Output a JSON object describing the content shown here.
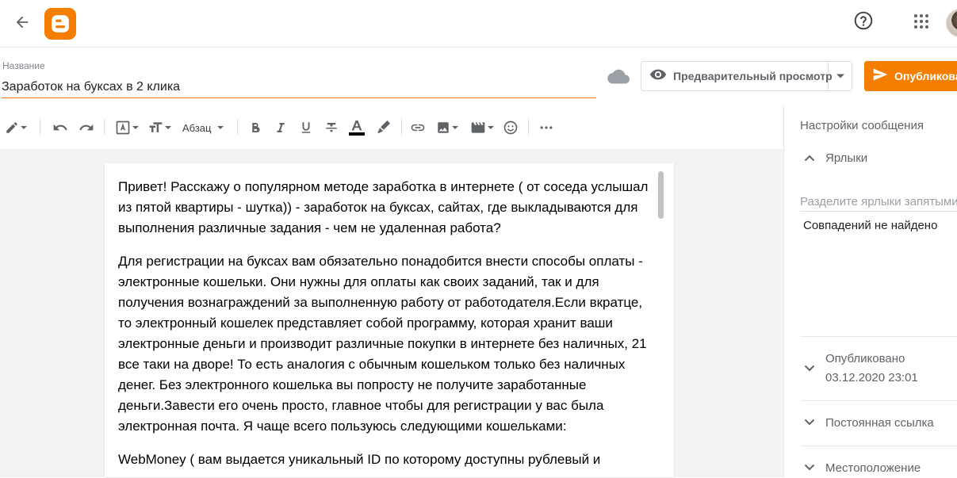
{
  "header": {
    "back_icon": "arrow-back-icon",
    "logo_icon": "blogger-logo-icon",
    "help_icon": "help-circle-icon",
    "apps_icon": "apps-grid-icon",
    "brand_color": "#f57d00"
  },
  "post": {
    "title_label": "Название",
    "title_value": "Заработок на буксах в 2 клика"
  },
  "actions": {
    "preview_label": "Предварительный просмотр",
    "publish_label": "Опубликовать"
  },
  "toolbar": {
    "paragraph_label": "Абзац"
  },
  "content": {
    "paragraphs": [
      "Привет! Расскажу о популярном методе заработка в интернете ( от соседа услышал из пятой квартиры - шутка)) - заработок на буксах, сайтах, где выкладываются для выполнения различные задания - чем не удаленная работа?",
      "Для регистрации на буксах вам обязательно понадобится внести способы оплаты - электронные кошельки. Они нужны для оплаты как своих заданий, так и для получения вознаграждений за выполненную работу от работодателя.Если вкратце, то электронный кошелек представляет собой программу, которая хранит ваши электронные деньги и производит различные покупки в интернете без наличных, 21 все таки на дворе! То есть аналогия с обычным кошельком только без наличных денег. Без электронного кошелька вы попросту не получите заработанные деньги.Завести его очень просто, главное чтобы для регистрации у вас была электронная почта. Я чаще всего пользуюсь следующими кошельками:",
      "WebMoney ( вам выдается уникальный ID по которому доступны рублевый и"
    ]
  },
  "sidebar": {
    "title": "Настройки сообщения",
    "labels_section": "Ярлыки",
    "labels_placeholder": "Разделите ярлыки запятыми",
    "no_matches": "Совпадений не найдено",
    "published_label": "Опубликовано",
    "published_date": "03.12.2020 23:01",
    "permalink_label": "Постоянная ссылка",
    "location_label": "Местоположение"
  }
}
